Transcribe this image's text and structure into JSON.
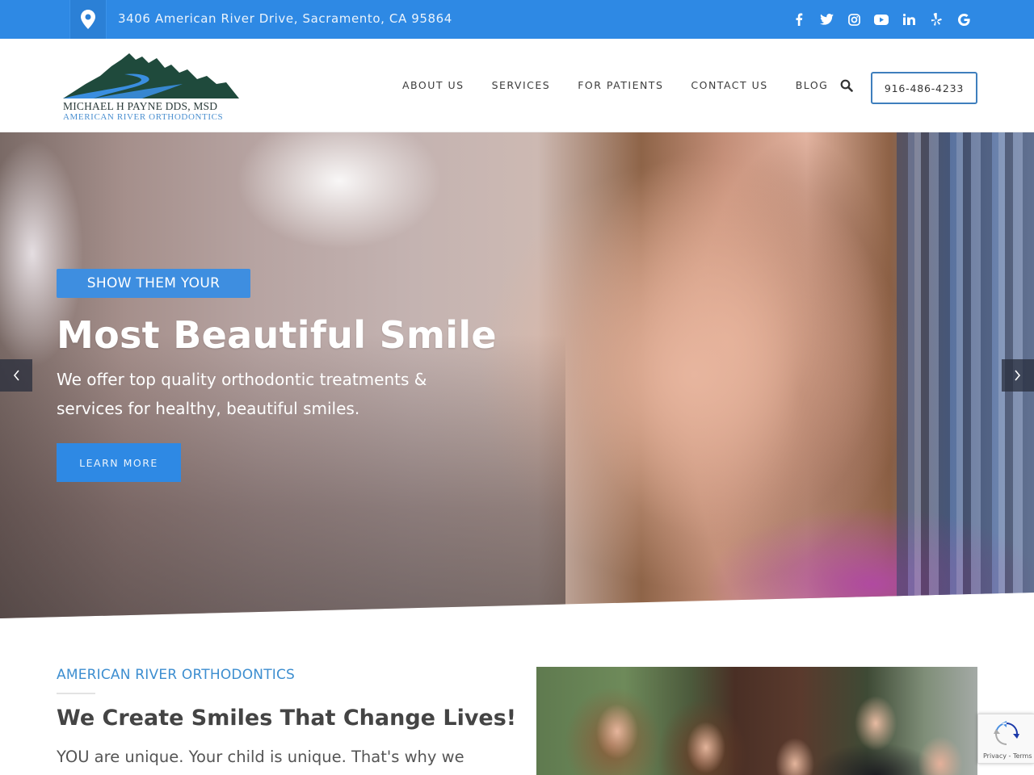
{
  "topbar": {
    "address": "3406 American River Drive, Sacramento, CA 95864",
    "location_icon": "map-pin-icon",
    "socials": [
      {
        "name": "facebook",
        "glyph": "f"
      },
      {
        "name": "twitter",
        "glyph": "🐦"
      },
      {
        "name": "instagram",
        "glyph": "◎"
      },
      {
        "name": "youtube",
        "glyph": "▶"
      },
      {
        "name": "linkedin",
        "glyph": "in"
      },
      {
        "name": "yelp",
        "glyph": "✱"
      },
      {
        "name": "google",
        "glyph": "G"
      }
    ]
  },
  "header": {
    "logo": {
      "line1": "MICHAEL H PAYNE DDS, MSD",
      "line2": "AMERICAN RIVER ORTHODONTICS"
    },
    "nav": [
      {
        "label": "ABOUT US"
      },
      {
        "label": "SERVICES"
      },
      {
        "label": "FOR PATIENTS"
      },
      {
        "label": "CONTACT US"
      },
      {
        "label": "BLOG"
      }
    ],
    "phone": "916-486-4233"
  },
  "hero": {
    "tagline": "SHOW THEM YOUR",
    "title": "Most Beautiful Smile",
    "subtitle": "We offer top quality orthodontic treatments & services for healthy, beautiful smiles.",
    "cta": "LEARN MORE",
    "prev_glyph": "‹",
    "next_glyph": "›"
  },
  "about": {
    "eyebrow": "AMERICAN RIVER ORTHODONTICS",
    "title": "We Create Smiles That Change Lives!",
    "body": "YOU are unique. Your child is unique. That's why we"
  },
  "recaptcha": {
    "text": "Privacy - Terms"
  },
  "colors": {
    "brand_blue": "#2e89e4",
    "eyebrow_blue": "#3d8ed0",
    "logo_green": "#1f4a3c",
    "logo_river": "#3a8ee0"
  }
}
